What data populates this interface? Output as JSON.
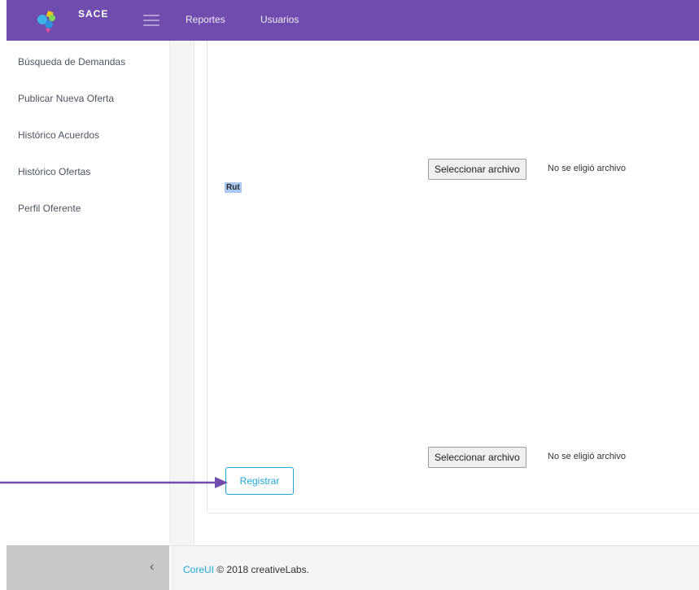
{
  "header": {
    "brand": "SACE",
    "nav": [
      {
        "label": "Reportes"
      },
      {
        "label": "Usuarios"
      }
    ]
  },
  "sidebar": {
    "items": [
      {
        "label": "Búsqueda de Demandas"
      },
      {
        "label": "Publicar Nueva Oferta"
      },
      {
        "label": "Histórico Acuerdos"
      },
      {
        "label": "Histórico Ofertas"
      },
      {
        "label": "Perfil Oferente"
      }
    ]
  },
  "form": {
    "field_label": "Rut",
    "file_inputs": [
      {
        "button_label": "Seleccionar archivo",
        "status": "No se eligió archivo"
      },
      {
        "button_label": "Seleccionar archivo",
        "status": "No se eligió archivo"
      }
    ],
    "submit_label": "Registrar"
  },
  "footer": {
    "link": "CoreUI",
    "text": " © 2018 creativeLabs."
  },
  "colors": {
    "header_bg": "#6f4cad",
    "accent": "#20a8d8",
    "annotation_arrow": "#6f4cad"
  },
  "icons": {
    "menu": "hamburger-icon",
    "sidebar_toggle": "chevron-left-icon",
    "logo": "sace-logo-icon"
  }
}
